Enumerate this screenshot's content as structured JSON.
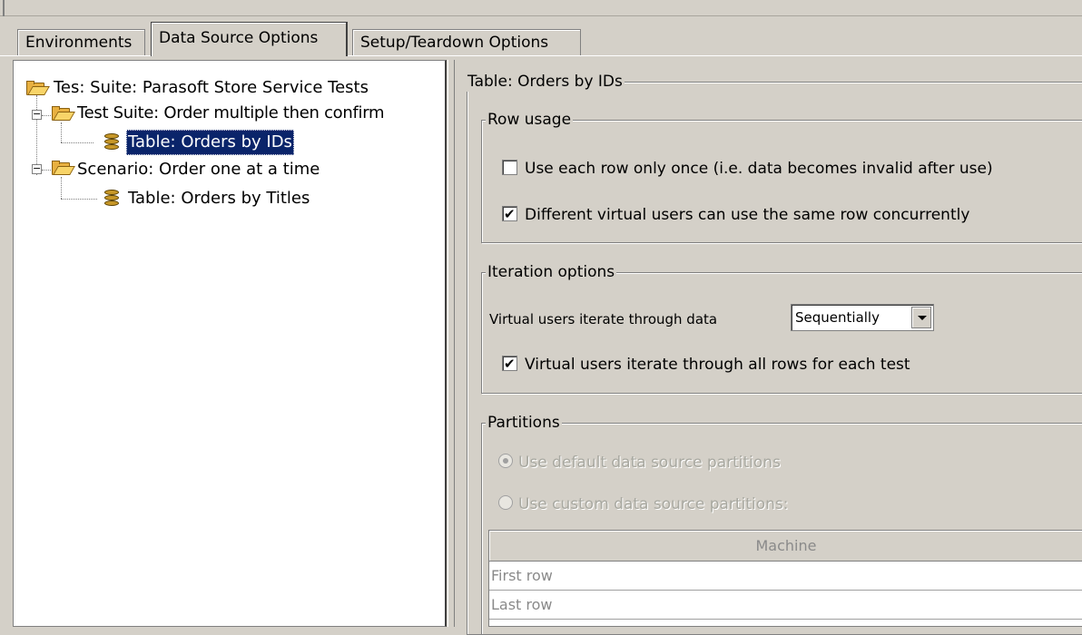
{
  "tabs": [
    {
      "label": "Environments",
      "active": false
    },
    {
      "label": "Data Source Options",
      "active": true
    },
    {
      "label": "Setup/Teardown Options",
      "active": false
    }
  ],
  "tree": {
    "root": {
      "label": "Tes: Suite: Parasoft Store Service Tests",
      "icon": "folder-icon"
    },
    "items": [
      {
        "label": "Test Suite: Order multiple then confirm",
        "icon": "folder-icon",
        "expander": "−"
      },
      {
        "label": "Table: Orders by IDs",
        "icon": "database-table-icon",
        "selected": true
      },
      {
        "label": "Scenario: Order one at a time",
        "icon": "folder-icon",
        "expander": "−"
      },
      {
        "label": "Table: Orders by Titles",
        "icon": "database-table-icon"
      }
    ]
  },
  "details": {
    "title": "Table: Orders by IDs",
    "row_usage": {
      "title": "Row usage",
      "use_once": {
        "label": "Use each row only once (i.e. data becomes invalid after use)",
        "checked": false
      },
      "concurrent": {
        "label": "Different virtual users can use the same row concurrently",
        "checked": true
      }
    },
    "iteration": {
      "title": "Iteration options",
      "iterate_label": "Virtual users iterate through data",
      "iterate_value": "Sequentially",
      "all_rows": {
        "label": "Virtual users iterate through all rows for each test",
        "checked": true
      }
    },
    "partitions": {
      "title": "Partitions",
      "default_label": "Use default data source partitions",
      "custom_label": "Use custom data source partitions:",
      "selected": "default",
      "table_header": "Machine",
      "rows": [
        "First row",
        "Last row"
      ]
    }
  },
  "colors": {
    "selection": "#0a246a",
    "panel": "#d4d0c8",
    "disabled": "#a8a8a0"
  }
}
